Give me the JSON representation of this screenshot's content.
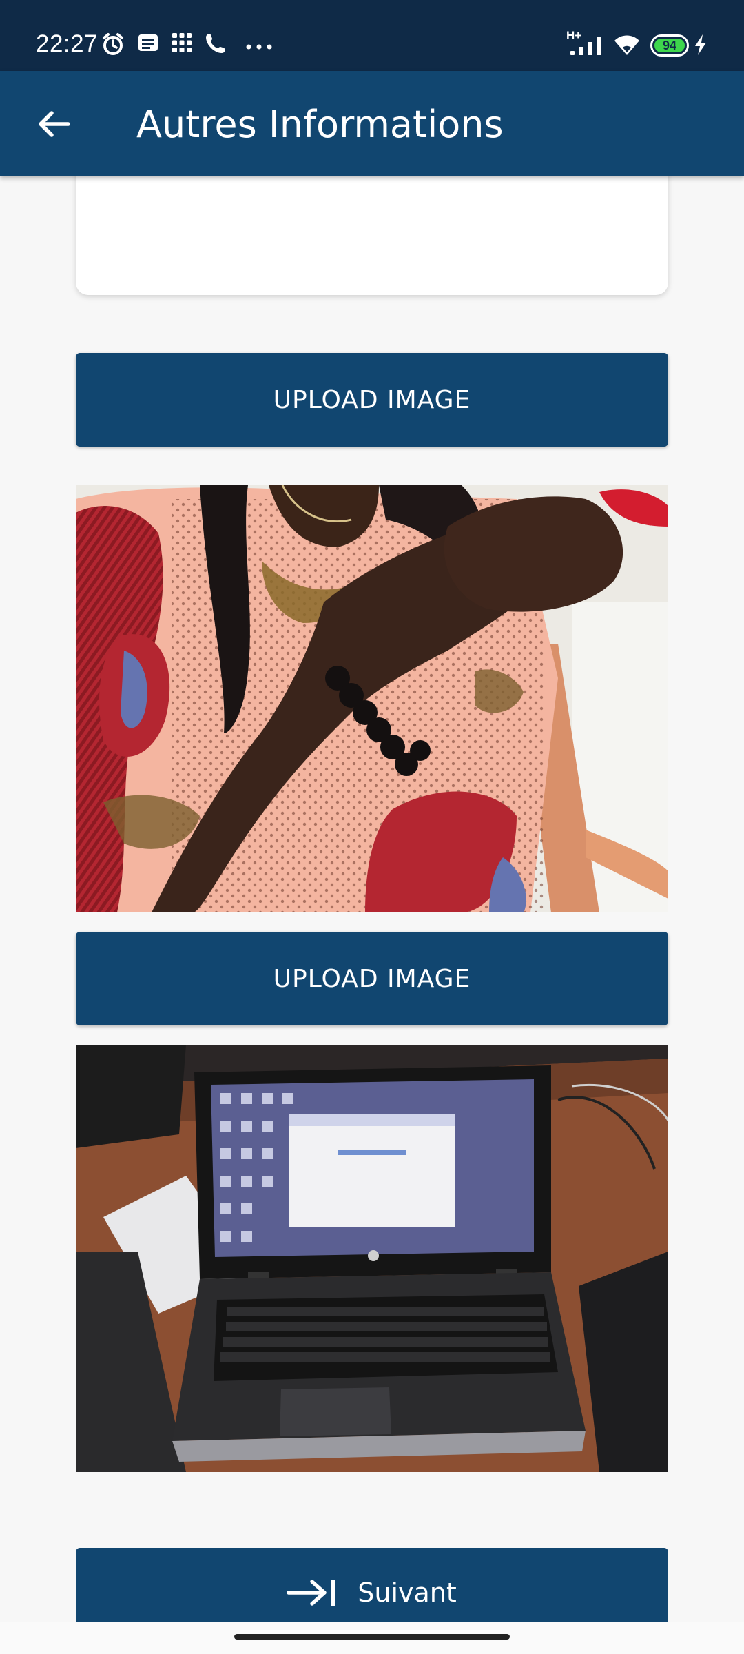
{
  "status_bar": {
    "time": "22:27",
    "network": "H+",
    "battery": "94",
    "icons": [
      "alarm-icon",
      "message-icon",
      "apps-grid-icon",
      "phone-icon",
      "more-dots-icon",
      "signal-icon",
      "wifi-icon",
      "battery-icon",
      "charging-icon"
    ]
  },
  "app_bar": {
    "back_icon": "back-arrow-icon",
    "title": "Autres Informations"
  },
  "content": {
    "upload_button_1_label": "UPLOAD IMAGE",
    "upload_button_2_label": "UPLOAD IMAGE",
    "next_button_label": "Suivant",
    "next_icon": "arrow-to-bar-icon"
  },
  "colors": {
    "status_bar_bg": "#0f2a47",
    "app_bar_bg": "#114670",
    "button_bg": "#114670",
    "page_bg": "#f7f7f7",
    "battery_green": "#3ed64c"
  }
}
